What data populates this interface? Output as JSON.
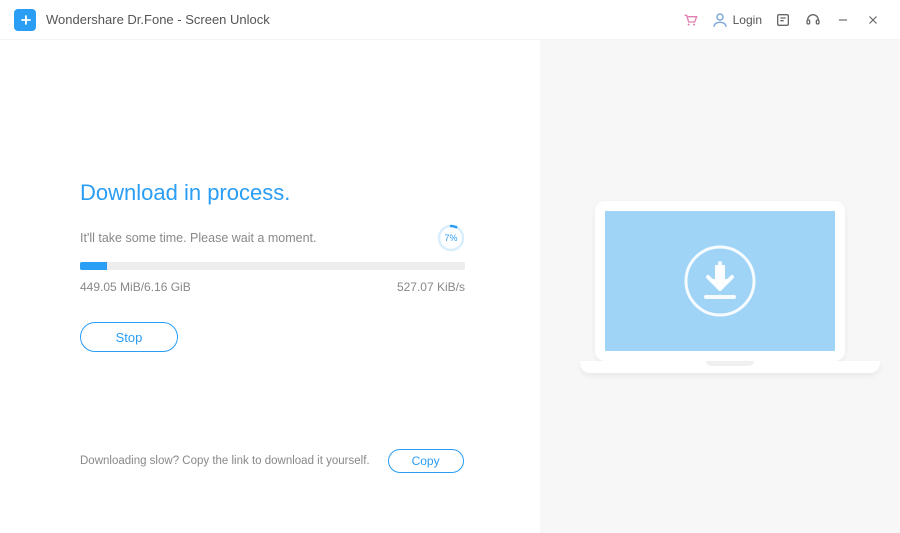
{
  "titlebar": {
    "app_title": "Wondershare Dr.Fone - Screen Unlock",
    "login_label": "Login"
  },
  "main": {
    "heading": "Download in process.",
    "subtext": "It'll take some time. Please wait a moment.",
    "progress_percent_label": "7%",
    "progress_percent": 7,
    "downloaded_total": "449.05 MiB/6.16 GiB",
    "speed": "527.07 KiB/s",
    "stop_label": "Stop"
  },
  "footer": {
    "slow_text": "Downloading slow? Copy the link to download it yourself.",
    "copy_label": "Copy"
  },
  "colors": {
    "accent": "#2a9df4"
  }
}
